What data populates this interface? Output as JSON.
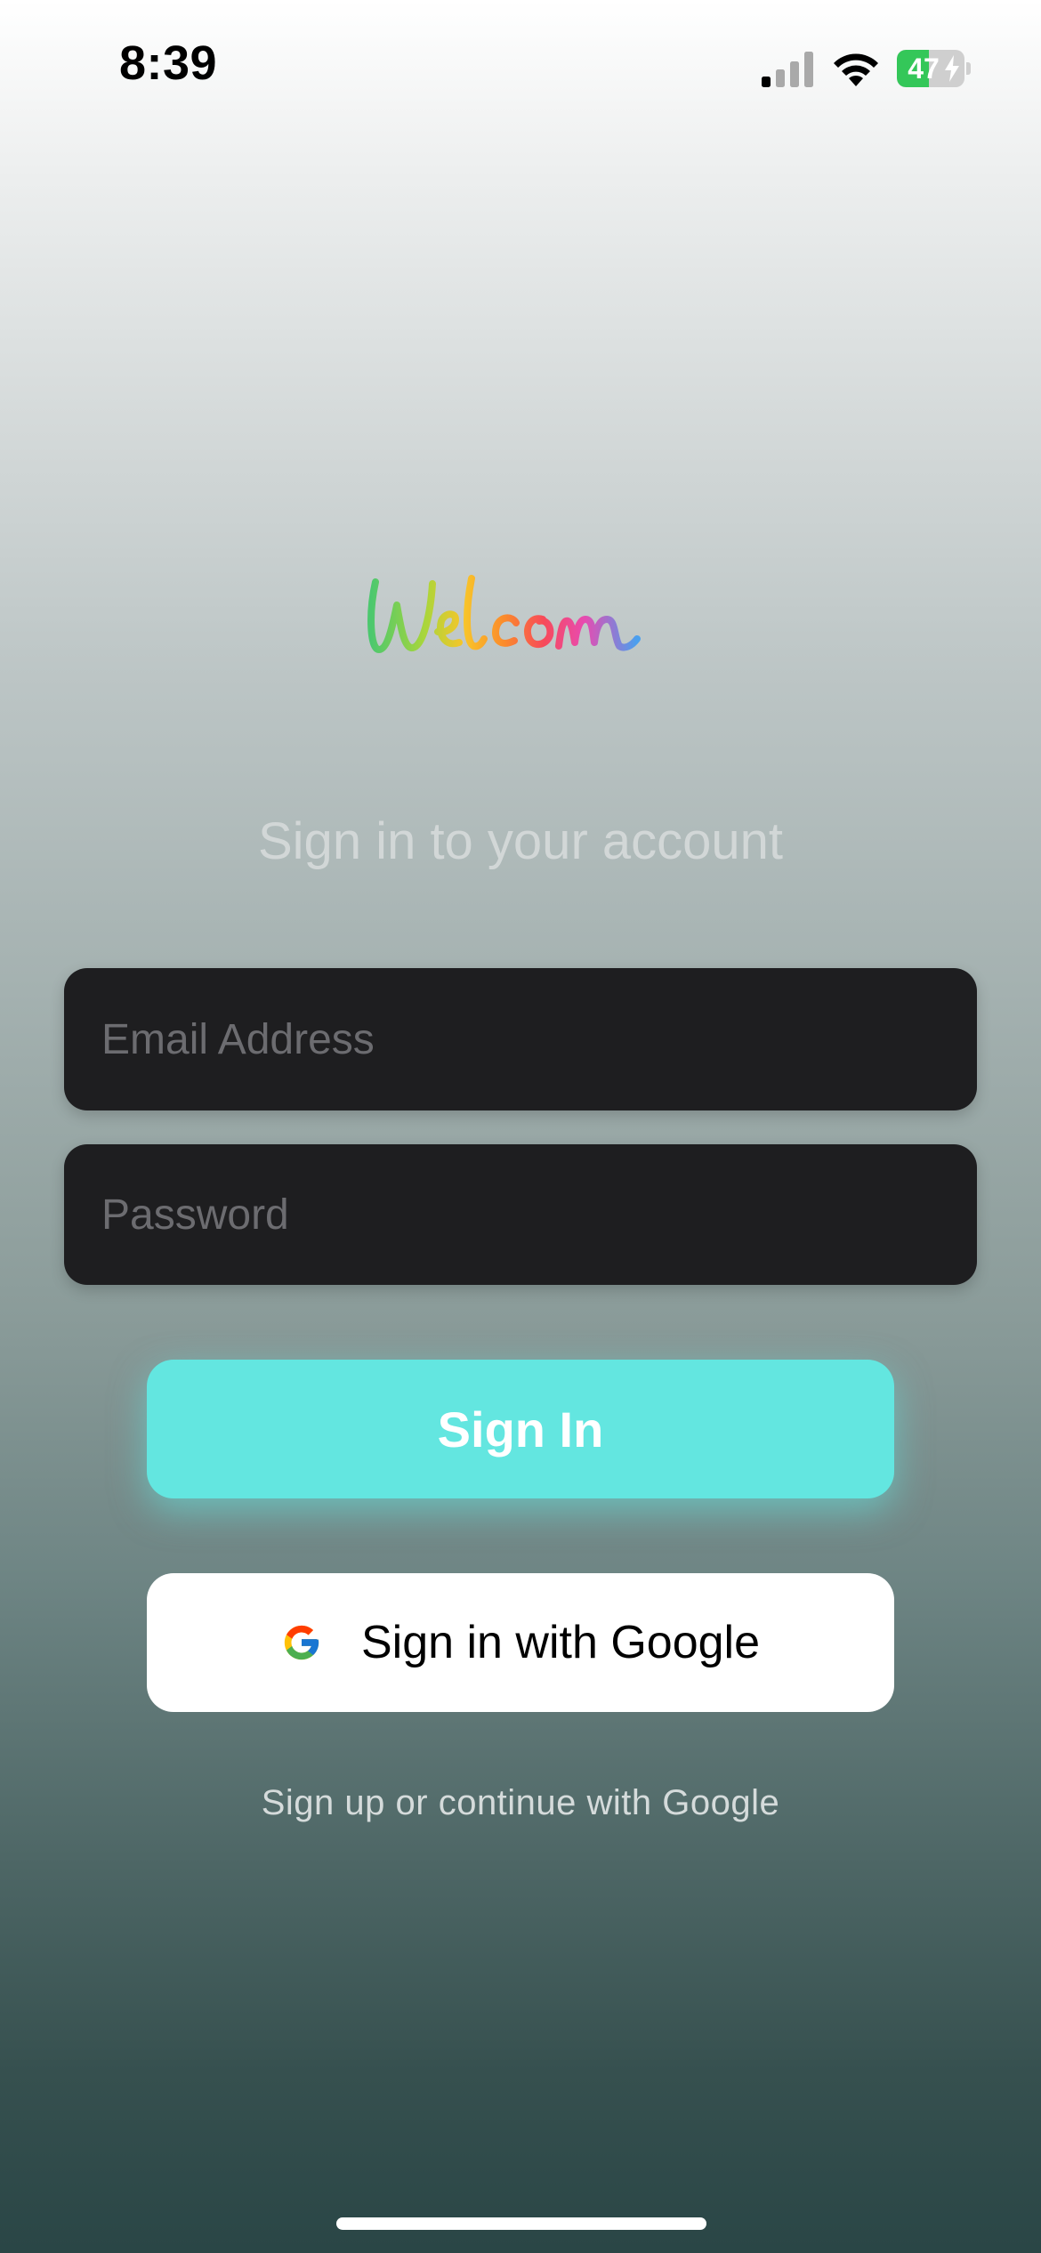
{
  "status_bar": {
    "time": "8:39",
    "battery_level": "47",
    "battery_fraction": 0.47,
    "battery_color": "#34c759",
    "icons": [
      "cellular-signal-icon",
      "wifi-icon",
      "battery-icon"
    ]
  },
  "logo": {
    "text": "Welcom"
  },
  "subtitle": "Sign in to your account",
  "form": {
    "email_placeholder": "Email Address",
    "email_value": "",
    "password_placeholder": "Password",
    "password_value": ""
  },
  "buttons": {
    "sign_in_label": "Sign In",
    "sign_in_color": "#63e6e0",
    "google_label": "Sign in with Google",
    "google_icon": "google-g-icon"
  },
  "footer": {
    "text": "Sign up or continue with Google"
  }
}
